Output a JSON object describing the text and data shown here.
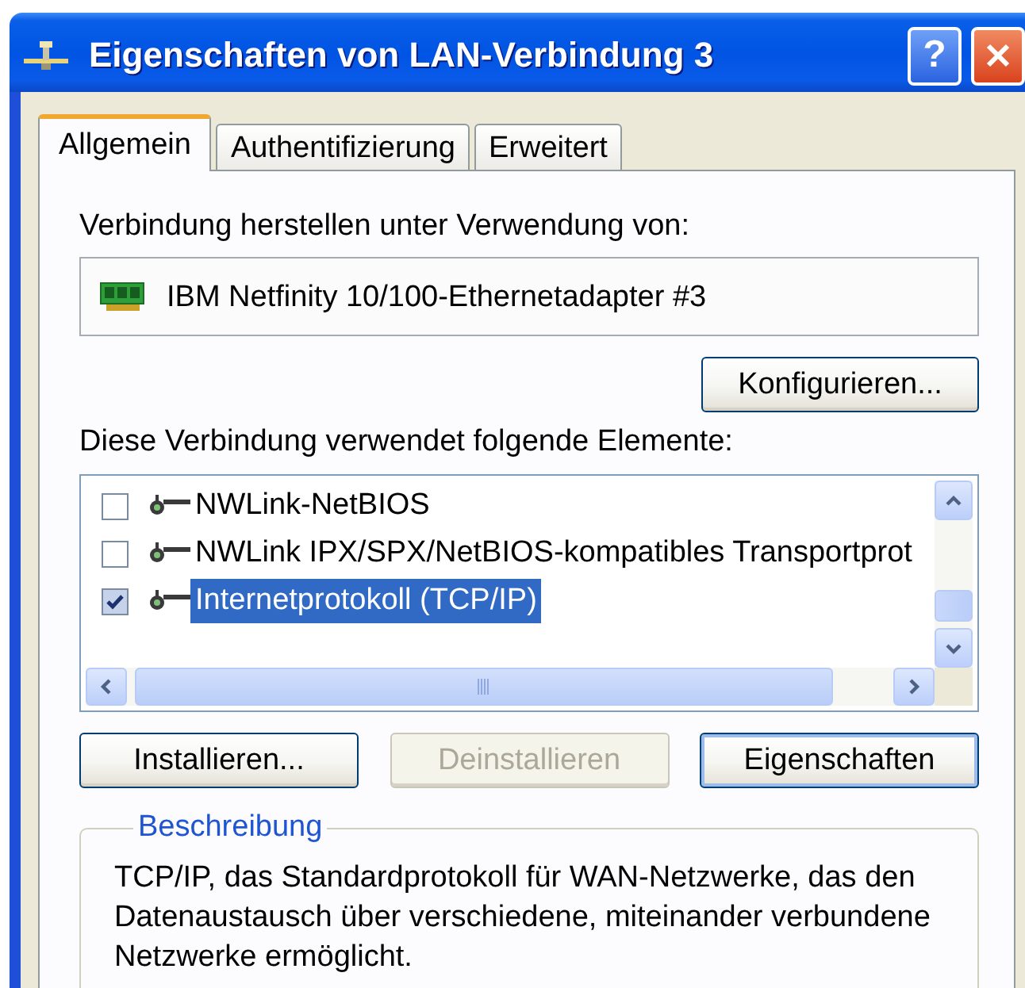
{
  "window": {
    "title": "Eigenschaften von LAN-Verbindung 3",
    "help_button": "?"
  },
  "tabs": [
    {
      "label": "Allgemein",
      "selected": true
    },
    {
      "label": "Authentifizierung",
      "selected": false
    },
    {
      "label": "Erweitert",
      "selected": false
    }
  ],
  "connect_using": {
    "label": "Verbindung herstellen unter Verwendung von:",
    "adapter": "IBM Netfinity 10/100-Ethernetadapter #3",
    "button": {
      "label": "Konfigurieren...",
      "disabled": false,
      "default": false
    }
  },
  "components": {
    "label": "Diese Verbindung verwendet folgende Elemente:",
    "items": [
      {
        "label": "NWLink-NetBIOS",
        "checked": false,
        "selected": false
      },
      {
        "label": "NWLink IPX/SPX/NetBIOS-kompatibles Transportprot",
        "checked": false,
        "selected": false
      },
      {
        "label": "Internetprotokoll (TCP/IP)",
        "checked": true,
        "selected": true
      }
    ]
  },
  "buttons": [
    {
      "label": "Installieren...",
      "disabled": false,
      "default": false
    },
    {
      "label": "Deinstallieren",
      "disabled": true,
      "default": false
    },
    {
      "label": "Eigenschaften",
      "disabled": false,
      "default": true
    }
  ],
  "description": {
    "title": "Beschreibung",
    "text": "TCP/IP, das Standardprotokoll für WAN-Netzwerke, das den Datenaustausch über verschiedene, miteinander verbundene Netzwerke ermöglicht."
  }
}
